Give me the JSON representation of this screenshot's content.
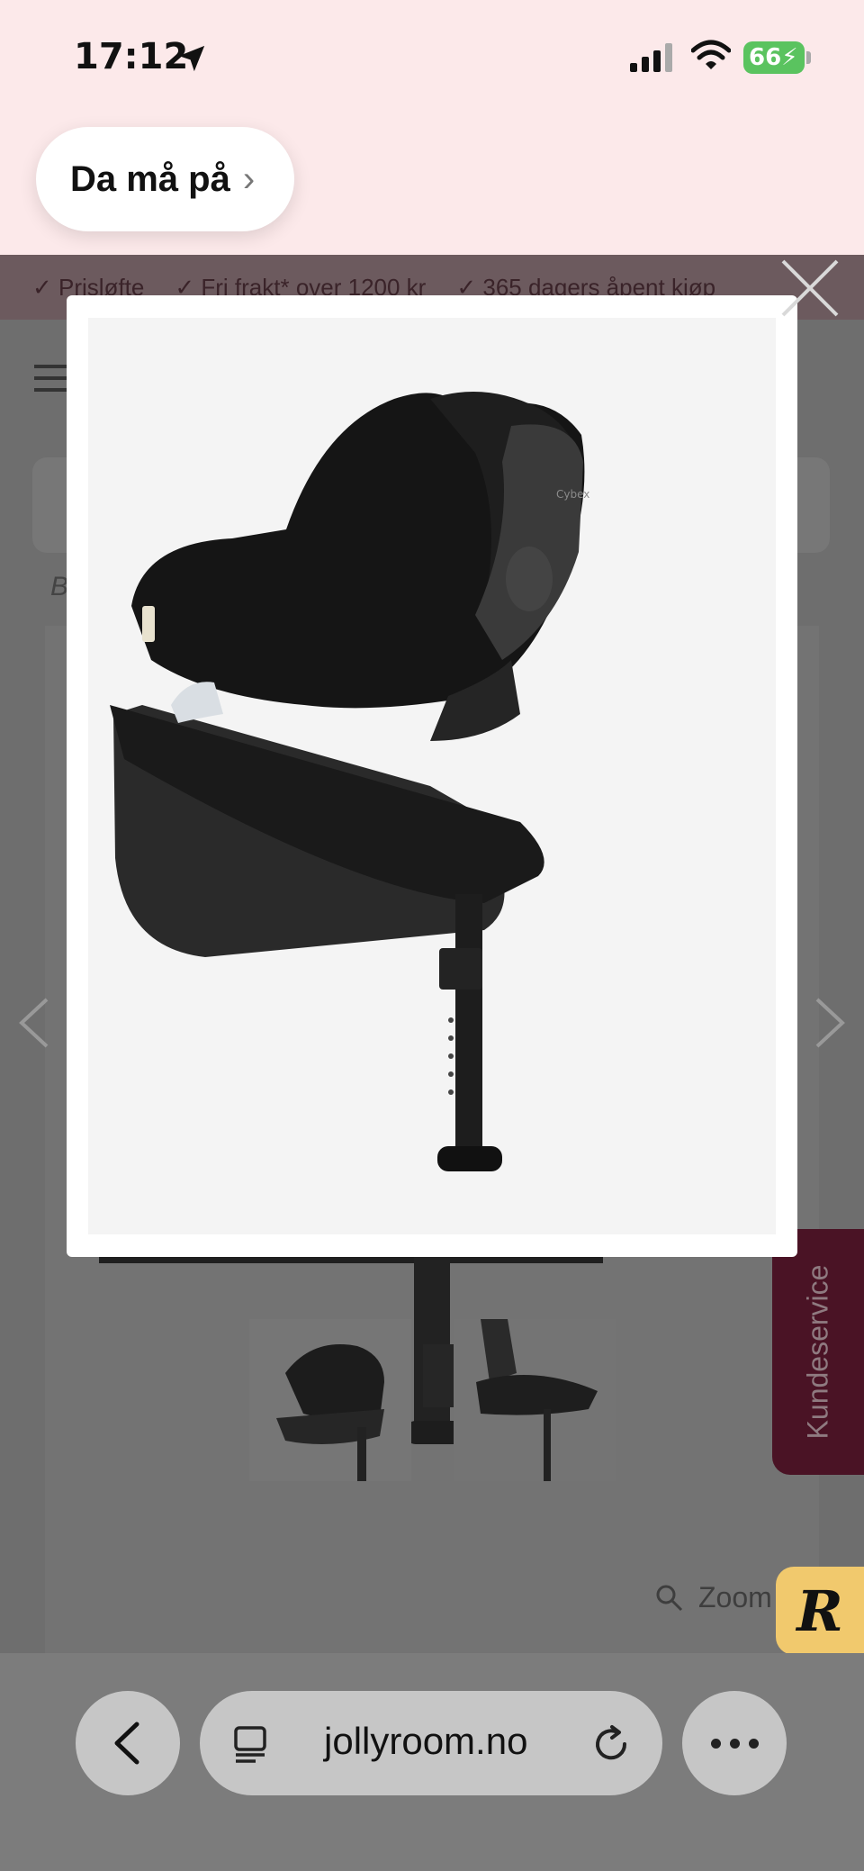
{
  "status_bar": {
    "time": "17:12",
    "battery": "66"
  },
  "back_pill": {
    "label": "Da må på",
    "chevron": "›"
  },
  "usp_bar": {
    "items": [
      "✓ Prisløfte",
      "✓ Fri frakt* over 1200 kr",
      "✓ 365 dagers åpent kjøp"
    ]
  },
  "breadcrumb": {
    "text": "B"
  },
  "product": {
    "zoom_label": "Zoom",
    "thumbnails": [
      "thumbnail-1",
      "thumbnail-2"
    ]
  },
  "kundeservice": {
    "label": "Kundeservice"
  },
  "r_badge": {
    "label": "R"
  },
  "browser": {
    "url": "jollyroom.no"
  },
  "colors": {
    "top_bg": "#fce9ea",
    "kundeservice_bg": "#4a1325",
    "badge_bg": "#f1c96d",
    "battery": "#5ac35f"
  }
}
